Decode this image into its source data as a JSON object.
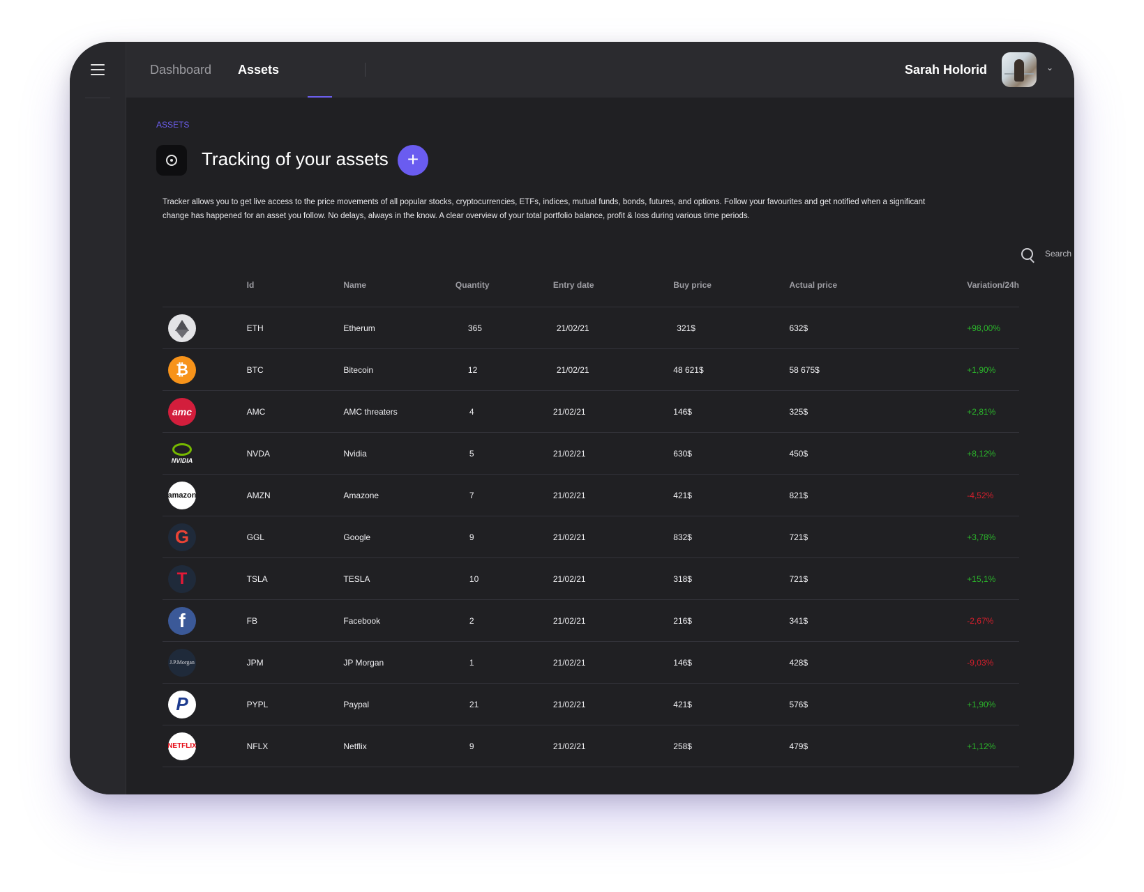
{
  "header": {
    "tabs": [
      "Dashboard",
      "Assets"
    ],
    "active_tab": "Assets",
    "user_name": "Sarah Holorid"
  },
  "page": {
    "breadcrumb": "ASSETS",
    "title": "Tracking of your assets",
    "add_label": "+",
    "description": "Tracker allows you to get live access to the price movements of all popular stocks, cryptocurrencies, ETFs, indices, mutual funds, bonds, futures, and options. Follow your favourites and get notified when a significant change has happened for an asset you follow. No delays, always in the know. A clear overview of your total portfolio balance, profit & loss during various time periods.",
    "search_label": "Search"
  },
  "table": {
    "columns": [
      "Id",
      "Name",
      "Quantity",
      "Entry date",
      "Buy price",
      "Actual price",
      "Variation/24h"
    ],
    "rows": [
      {
        "logo": "ethereum-logo",
        "id": "ETH",
        "name": "Etherum",
        "quantity": "365",
        "entry_date": "21/02/21",
        "buy_price": "321$",
        "actual_price": "632$",
        "variation": "+98,00%"
      },
      {
        "logo": "bitcoin-logo",
        "id": "BTC",
        "name": "Bitecoin",
        "quantity": "12",
        "entry_date": "21/02/21",
        "buy_price": "48 621$",
        "actual_price": "58 675$",
        "variation": "+1,90%"
      },
      {
        "logo": "amc-logo",
        "id": "AMC",
        "name": "AMC threaters",
        "quantity": "4",
        "entry_date": "21/02/21",
        "buy_price": "146$",
        "actual_price": "325$",
        "variation": "+2,81%"
      },
      {
        "logo": "nvidia-logo",
        "id": "NVDA",
        "name": "Nvidia",
        "quantity": "5",
        "entry_date": "21/02/21",
        "buy_price": "630$",
        "actual_price": "450$",
        "variation": "+8,12%"
      },
      {
        "logo": "amazon-logo",
        "id": "AMZN",
        "name": "Amazone",
        "quantity": "7",
        "entry_date": "21/02/21",
        "buy_price": "421$",
        "actual_price": "821$",
        "variation": "-4,52%"
      },
      {
        "logo": "google-logo",
        "id": "GGL",
        "name": "Google",
        "quantity": "9",
        "entry_date": "21/02/21",
        "buy_price": "832$",
        "actual_price": "721$",
        "variation": "+3,78%"
      },
      {
        "logo": "tesla-logo",
        "id": "TSLA",
        "name": "TESLA",
        "quantity": "10",
        "entry_date": "21/02/21",
        "buy_price": "318$",
        "actual_price": "721$",
        "variation": "+15,1%"
      },
      {
        "logo": "facebook-logo",
        "id": "FB",
        "name": "Facebook",
        "quantity": "2",
        "entry_date": "21/02/21",
        "buy_price": "216$",
        "actual_price": "341$",
        "variation": "-2,67%"
      },
      {
        "logo": "jpmorgan-logo",
        "id": "JPM",
        "name": "JP Morgan",
        "quantity": "1",
        "entry_date": "21/02/21",
        "buy_price": "146$",
        "actual_price": "428$",
        "variation": "-9,03%"
      },
      {
        "logo": "paypal-logo",
        "id": "PYPL",
        "name": "Paypal",
        "quantity": "21",
        "entry_date": "21/02/21",
        "buy_price": "421$",
        "actual_price": "576$",
        "variation": "+1,90%"
      },
      {
        "logo": "netflix-logo",
        "id": "NFLX",
        "name": "Netflix",
        "quantity": "9",
        "entry_date": "21/02/21",
        "buy_price": "258$",
        "actual_price": "479$",
        "variation": "+1,12%"
      }
    ]
  },
  "logo_text": {
    "AMC": "amc",
    "NVDA": "NVIDIA",
    "AMZN": "amazon",
    "GGL": "G",
    "TSLA": "T",
    "FB": "f",
    "JPM": "J.P.Morgan",
    "PYPL": "P",
    "NFLX": "NETFLIX",
    "BTC": "₿"
  },
  "colors": {
    "accent": "#6d5ff0",
    "positive": "#2bb62b",
    "negative": "#d21f2c",
    "background": "#202023"
  }
}
